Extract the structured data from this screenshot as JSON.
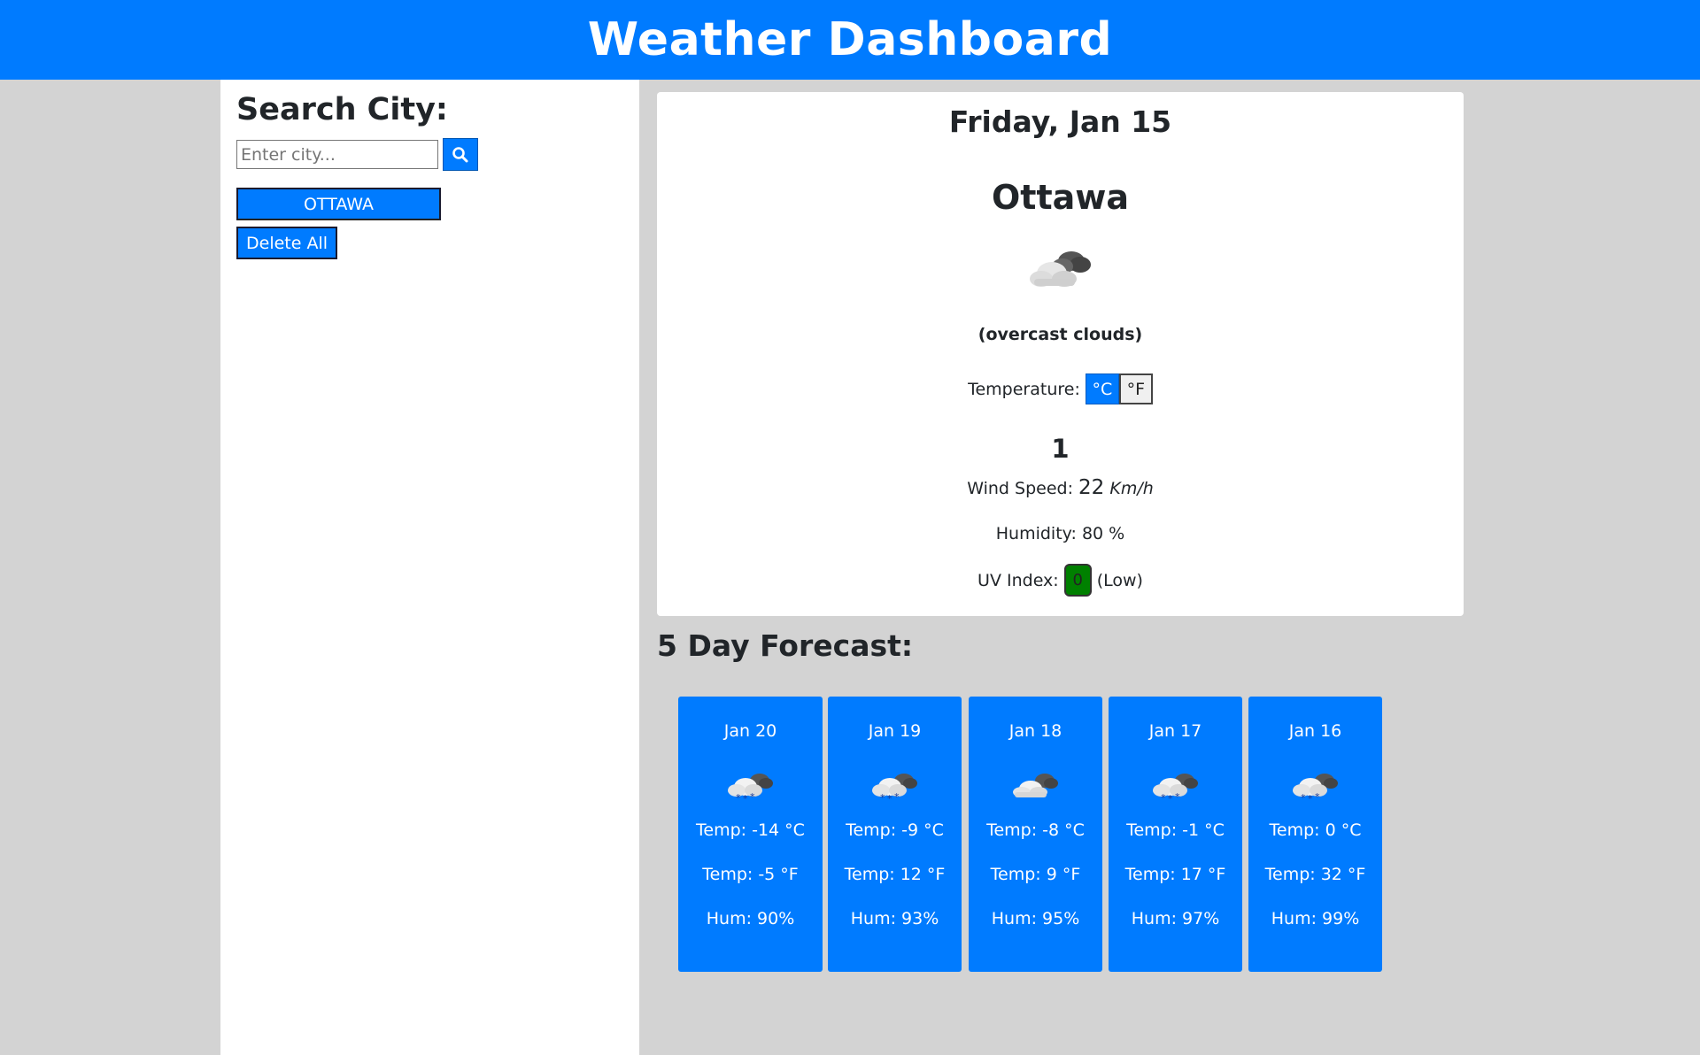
{
  "header": {
    "title": "Weather Dashboard"
  },
  "sidebar": {
    "title": "Search City:",
    "search_placeholder": "Enter city...",
    "saved_cities": [
      "OTTAWA"
    ],
    "delete_all_label": "Delete All"
  },
  "current": {
    "date": "Friday, Jan 15",
    "city": "Ottawa",
    "icon": "overcast-clouds-icon",
    "description": "(overcast clouds)",
    "temperature_label": "Temperature:",
    "unit_c": "°C",
    "unit_f": "°F",
    "active_unit": "C",
    "temperature": "1",
    "wind_label": "Wind Speed:",
    "wind_value": "22",
    "wind_unit": "Km/h",
    "humidity_text": "Humidity: 80 %",
    "uv_label": "UV Index:",
    "uv_value": "0",
    "uv_level": "(Low)",
    "uv_color": "#008000"
  },
  "forecast": {
    "title": "5 Day Forecast:",
    "days": [
      {
        "date": "Jan 20",
        "icon": "snow-clouds-icon",
        "temp_c": "Temp: -14 °C",
        "temp_f": "Temp: -5 °F",
        "humidity": "Hum: 90%"
      },
      {
        "date": "Jan 19",
        "icon": "snow-clouds-icon",
        "temp_c": "Temp: -9 °C",
        "temp_f": "Temp: 12 °F",
        "humidity": "Hum: 93%"
      },
      {
        "date": "Jan 18",
        "icon": "overcast-clouds-icon",
        "temp_c": "Temp: -8 °C",
        "temp_f": "Temp: 9 °F",
        "humidity": "Hum: 95%"
      },
      {
        "date": "Jan 17",
        "icon": "snow-clouds-icon",
        "temp_c": "Temp: -1 °C",
        "temp_f": "Temp: 17 °F",
        "humidity": "Hum: 97%"
      },
      {
        "date": "Jan 16",
        "icon": "snow-clouds-icon",
        "temp_c": "Temp: 0 °C",
        "temp_f": "Temp: 32 °F",
        "humidity": "Hum: 99%"
      }
    ]
  },
  "colors": {
    "accent": "#007bff",
    "background": "#d3d3d3",
    "card": "#ffffff"
  }
}
